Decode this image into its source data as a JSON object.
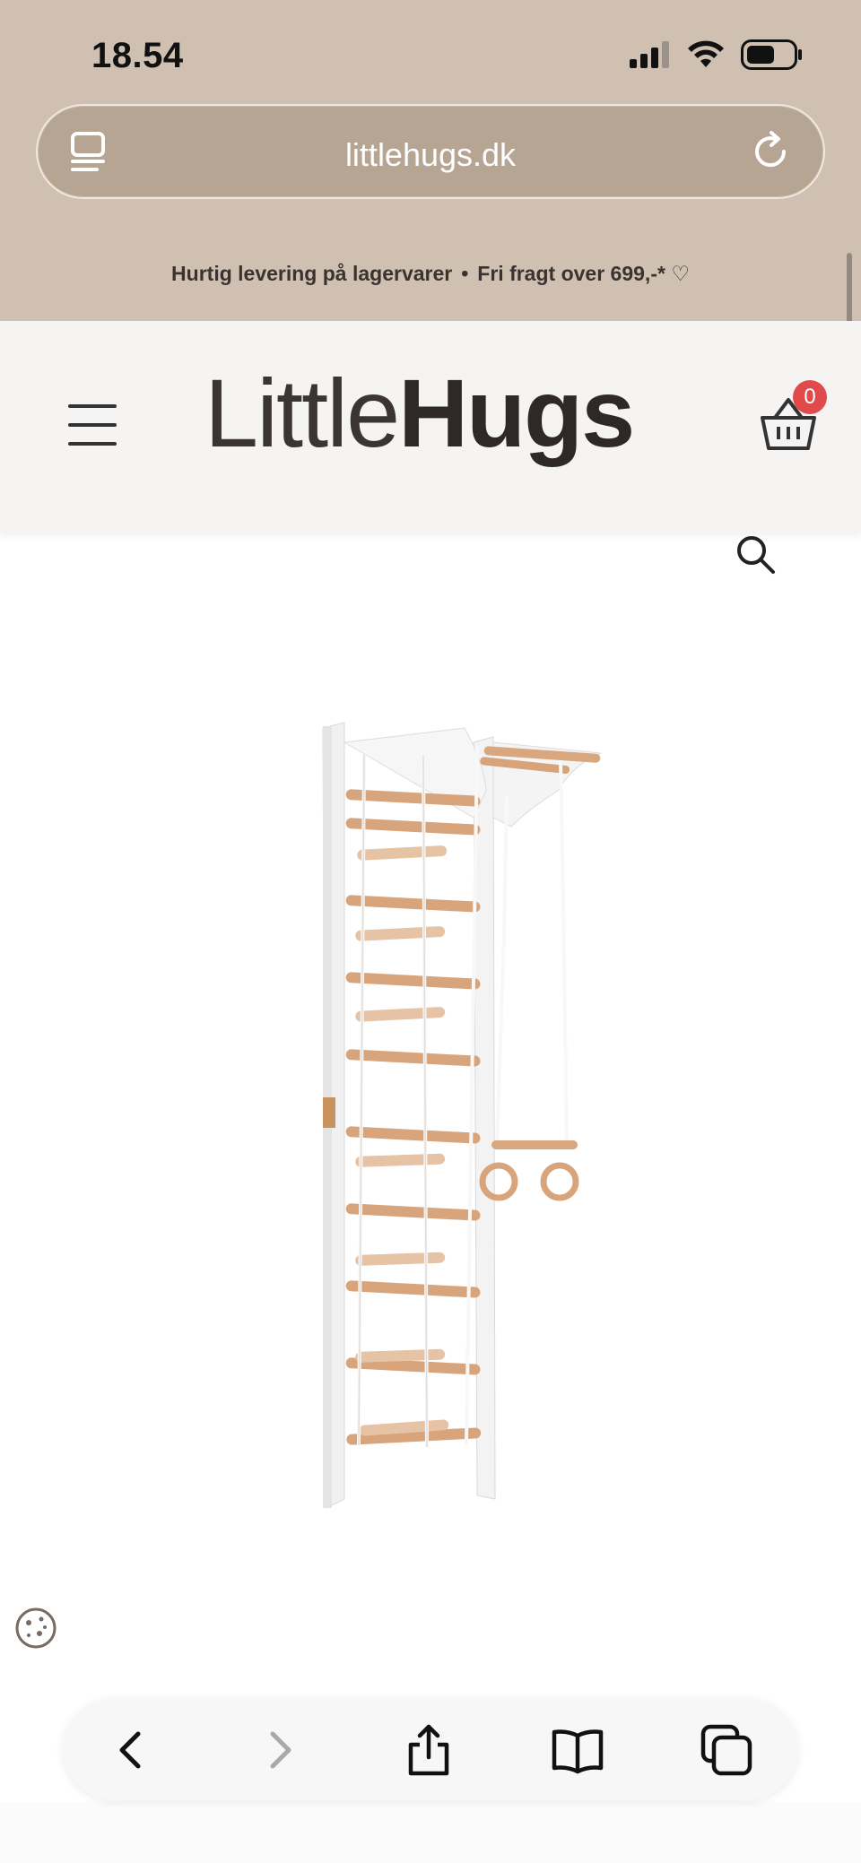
{
  "status": {
    "time": "18.54"
  },
  "browser": {
    "url": "littlehugs.dk"
  },
  "promo": {
    "part1": "Hurtig levering på lagervarer",
    "separator": "•",
    "part2": "Fri fragt over 699,-*",
    "heart": "♡"
  },
  "header": {
    "logo_light": "Little",
    "logo_bold": "Hugs",
    "cart_count": "0"
  },
  "product": {
    "image_name": "wall-bars-gym-ladder-image"
  },
  "colors": {
    "top_bg": "#cfc0b1",
    "header_bg": "#f6f4f2",
    "badge": "#e04a4a"
  }
}
